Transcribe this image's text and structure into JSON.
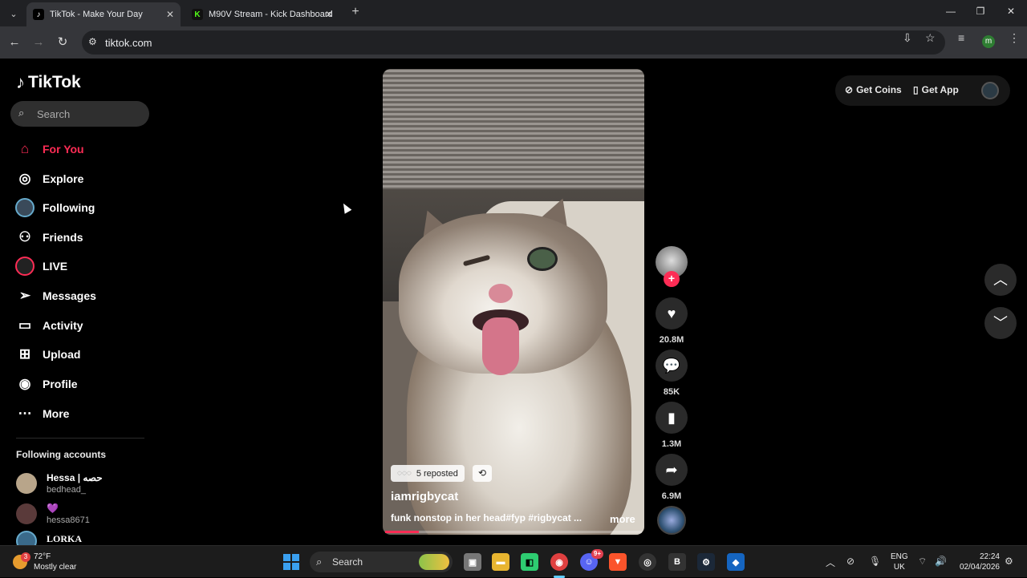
{
  "browser": {
    "tabs": [
      {
        "title": "TikTok - Make Your Day",
        "active": true
      },
      {
        "title": "M90V Stream - Kick Dashboard",
        "active": false
      }
    ],
    "url": "tiktok.com",
    "profile_initial": "m"
  },
  "sidebar": {
    "logo": "TikTok",
    "search_placeholder": "Search",
    "nav": [
      {
        "label": "For You",
        "icon": "home-icon"
      },
      {
        "label": "Explore",
        "icon": "compass-icon"
      },
      {
        "label": "Following",
        "icon": "following-avatar-icon"
      },
      {
        "label": "Friends",
        "icon": "friends-icon"
      },
      {
        "label": "LIVE",
        "icon": "live-icon"
      },
      {
        "label": "Messages",
        "icon": "send-icon"
      },
      {
        "label": "Activity",
        "icon": "activity-icon"
      },
      {
        "label": "Upload",
        "icon": "plus-box-icon"
      },
      {
        "label": "Profile",
        "icon": "profile-avatar-icon"
      },
      {
        "label": "More",
        "icon": "more-dots-icon"
      }
    ],
    "following_title": "Following accounts",
    "following": [
      {
        "name": "Hessa | حصه",
        "user": "bedhead_"
      },
      {
        "name": "💜",
        "user": "hessa8671"
      },
      {
        "name": "LORKA",
        "user": ""
      }
    ]
  },
  "video": {
    "reposted": "5 reposted",
    "author": "iamrigbycat",
    "caption": "funk nonstop in her head#fyp #rigbycat ...",
    "more": "more",
    "progress": 0.13
  },
  "actions": {
    "likes": "20.8M",
    "comments": "85K",
    "saves": "1.3M",
    "shares": "6.9M"
  },
  "topright": {
    "get_coins": "Get Coins",
    "get_app": "Get App"
  },
  "taskbar": {
    "temperature": "72°F",
    "weather": "Mostly clear",
    "weather_badge": "3",
    "search": "Search",
    "discord_badge": "9+",
    "lang_line1": "ENG",
    "lang_line2": "UK",
    "time": "22:24",
    "date": "02/04/2026"
  },
  "colors": {
    "accent": "#fe2c55",
    "background": "#000000"
  }
}
